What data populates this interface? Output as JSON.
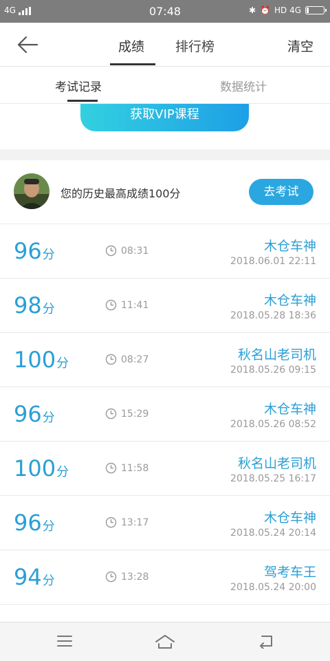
{
  "status_bar": {
    "network": "4G",
    "time": "07:48",
    "right_text": "HD 4G"
  },
  "header": {
    "tabs": [
      {
        "label": "成绩"
      },
      {
        "label": "排行榜"
      }
    ],
    "clear_label": "清空"
  },
  "sub_tabs": [
    {
      "label": "考试记录"
    },
    {
      "label": "数据统计"
    }
  ],
  "vip_button_label": "获取VIP课程",
  "best": {
    "text": "您的历史最高成绩100分",
    "button_label": "去考试"
  },
  "score_unit": "分",
  "records": [
    {
      "score": "96",
      "duration": "08:31",
      "name": "木仓车神",
      "date": "2018.06.01  22:11"
    },
    {
      "score": "98",
      "duration": "11:41",
      "name": "木仓车神",
      "date": "2018.05.28  18:36"
    },
    {
      "score": "100",
      "duration": "08:27",
      "name": "秋名山老司机",
      "date": "2018.05.26  09:15"
    },
    {
      "score": "96",
      "duration": "15:29",
      "name": "木仓车神",
      "date": "2018.05.26  08:52"
    },
    {
      "score": "100",
      "duration": "11:58",
      "name": "秋名山老司机",
      "date": "2018.05.25  16:17"
    },
    {
      "score": "96",
      "duration": "13:17",
      "name": "木仓车神",
      "date": "2018.05.24  20:14"
    },
    {
      "score": "94",
      "duration": "13:28",
      "name": "驾考车王",
      "date": "2018.05.24  20:00"
    },
    {
      "score": "",
      "duration": "",
      "name": "",
      "date": ""
    }
  ],
  "colors": {
    "accent": "#2a9fd6",
    "vip_start": "#33d0e0",
    "vip_end": "#1e9fe6",
    "partial_name": "#e8503a"
  },
  "icons": {
    "back": "arrow-left-icon",
    "clock": "clock-icon",
    "menu": "menu-icon",
    "home": "home-icon",
    "return": "return-icon"
  }
}
